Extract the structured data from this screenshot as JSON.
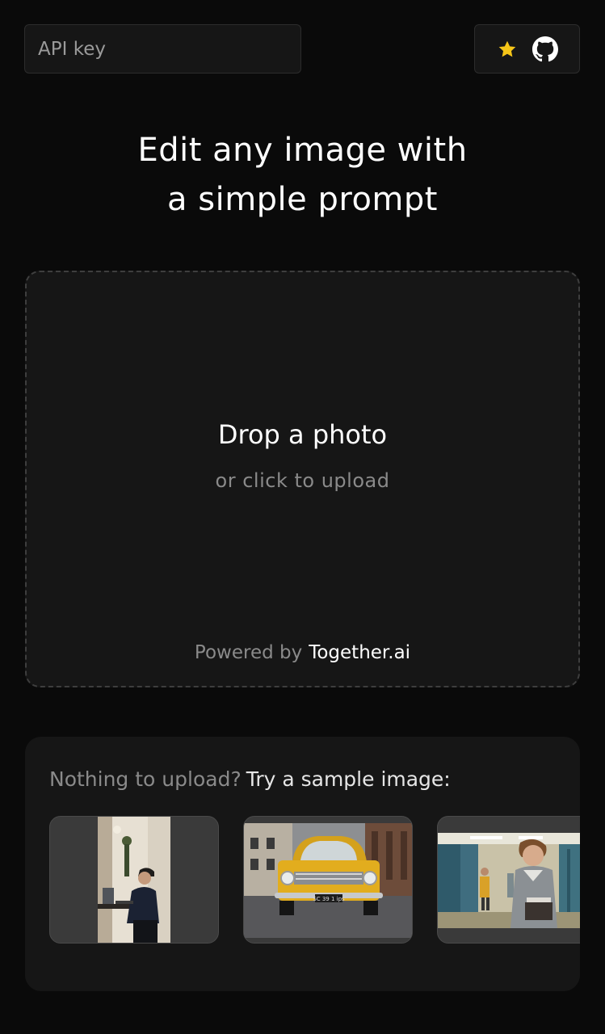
{
  "header": {
    "api_key_placeholder": "API key",
    "github": {
      "star_icon": "star-icon",
      "github_icon": "github-icon",
      "star_color": "#f5c518"
    }
  },
  "hero": {
    "title_line1": "Edit any image with",
    "title_line2": "a simple prompt"
  },
  "dropzone": {
    "title": "Drop a photo",
    "subtitle": "or click to upload",
    "powered_prefix": "Powered by",
    "powered_brand": "Together.ai"
  },
  "samples": {
    "heading_muted": "Nothing to upload?",
    "heading_strong": "Try a sample image:",
    "images": [
      {
        "id": "sample-cafe"
      },
      {
        "id": "sample-yellow-car",
        "plate": "SC 39 1 ips"
      },
      {
        "id": "sample-school-hallway"
      }
    ]
  },
  "colors": {
    "background": "#0a0a0a",
    "panel": "#161616",
    "muted_text": "#8a8a8a",
    "accent_star": "#f5c518"
  }
}
